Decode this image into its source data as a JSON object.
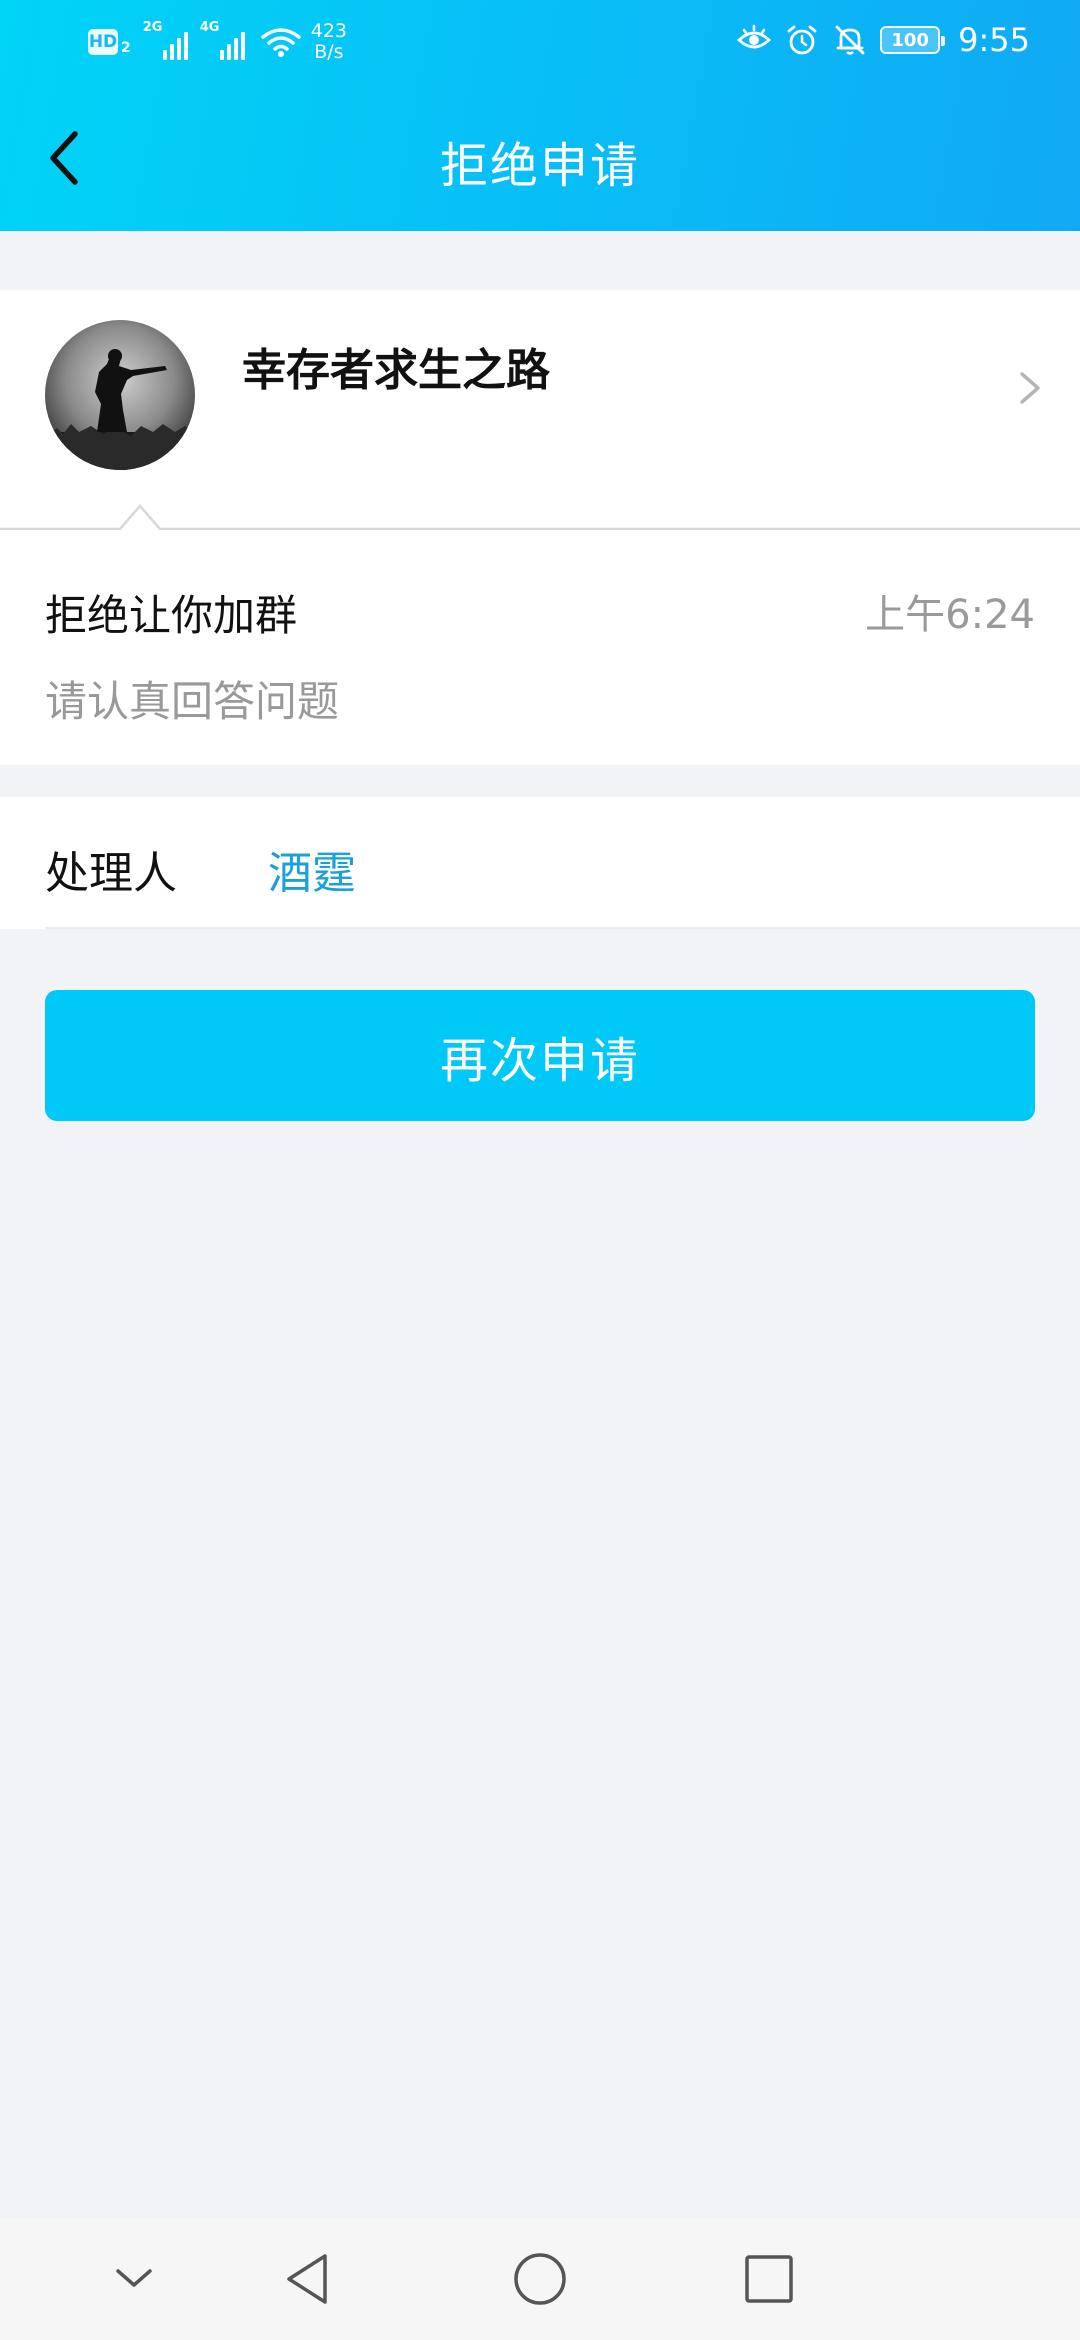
{
  "status_bar": {
    "hd_label": "HD",
    "hd_sub": "2",
    "sim1_tag": "2G",
    "sim2_tag": "4G",
    "speed_value": "423",
    "speed_unit": "B/s",
    "battery": "100",
    "time": "9:55",
    "icons": [
      "eye-comfort-icon",
      "alarm-icon",
      "bell-muted-icon"
    ]
  },
  "nav": {
    "title": "拒绝申请",
    "back_icon": "chevron-left-icon"
  },
  "group": {
    "name": "幸存者求生之路",
    "avatar_desc": "avatar-image"
  },
  "message": {
    "title": "拒绝让你加群",
    "time": "上午6:24",
    "detail": "请认真回答问题"
  },
  "handler": {
    "label": "处理人",
    "name": "酒霆"
  },
  "actions": {
    "reapply_label": "再次申请"
  },
  "system_nav": [
    "chevron-down-icon",
    "back-triangle-icon",
    "home-circle-icon",
    "recents-square-icon"
  ],
  "colors": {
    "header_start": "#00d4f7",
    "header_end": "#10a9f5",
    "button": "#00c9f7",
    "link": "#1aa1d8",
    "background": "#f2f3f7"
  }
}
